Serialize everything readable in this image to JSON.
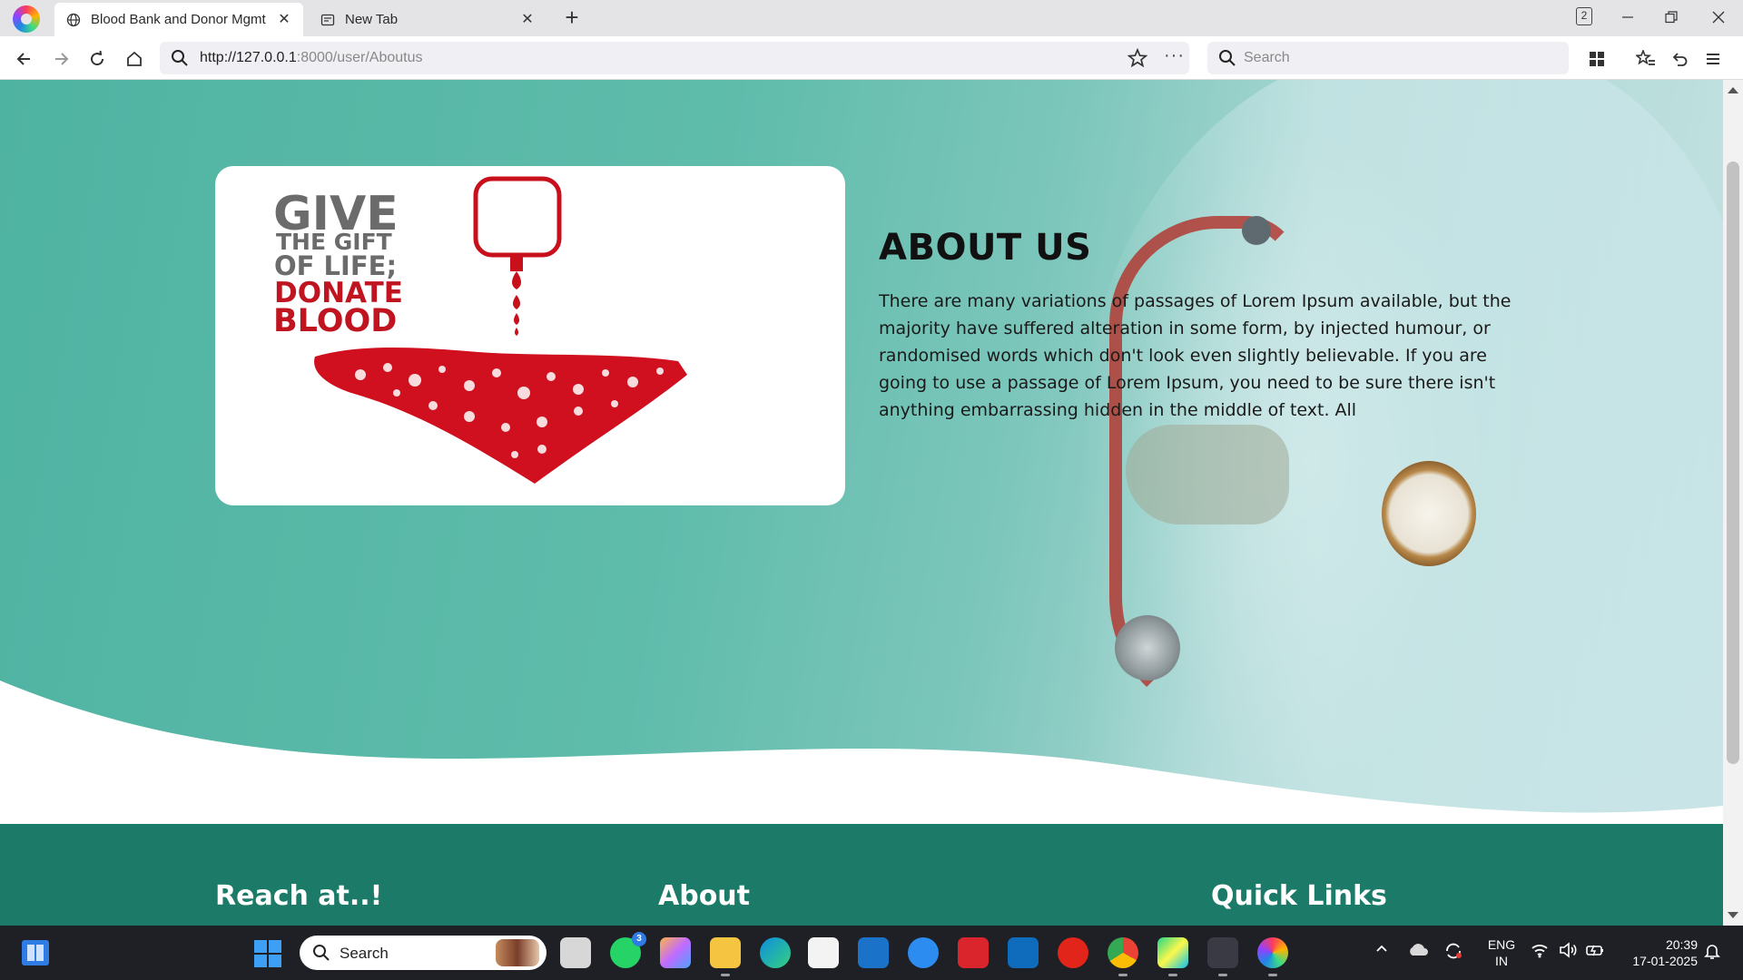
{
  "browser": {
    "tabs": [
      {
        "title": "Blood Bank and Donor Mgmt",
        "active": true
      },
      {
        "title": "New Tab",
        "active": false
      }
    ],
    "tab_count": "2",
    "url": {
      "host": "http://127.0.0.1",
      "path": ":8000/user/Aboutus"
    },
    "search_placeholder": "Search"
  },
  "page": {
    "hero_image": {
      "line1": "GIVE",
      "line2": "THE GIFT",
      "line3": "OF LIFE;",
      "line4": "DONATE",
      "line5": "BLOOD"
    },
    "about": {
      "heading": "ABOUT US",
      "body": "There are many variations of passages of Lorem Ipsum available, but the majority have suffered alteration in some form, by injected humour, or randomised words which don't look even slightly believable. If you are going to use a passage of Lorem Ipsum, you need to be sure there isn't anything embarrassing hidden in the middle of text. All"
    },
    "footer": {
      "reach_heading": "Reach at..!",
      "about_heading": "About",
      "links_heading": "Quick Links"
    }
  },
  "taskbar": {
    "search_label": "Search",
    "whatsapp_badge": "3",
    "tray": {
      "language_line1": "ENG",
      "language_line2": "IN",
      "time": "20:39",
      "date": "17-01-2025"
    }
  },
  "colors": {
    "hero_teal": "#4fb3a2",
    "footer_green": "#1b7b68",
    "blood_red": "#d0101e"
  }
}
